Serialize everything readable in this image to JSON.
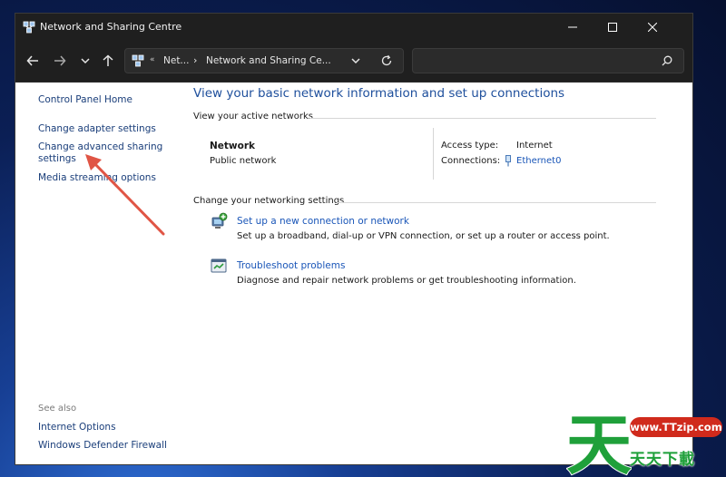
{
  "window": {
    "title": "Network and Sharing Centre"
  },
  "address_bar": {
    "overflow": "«",
    "crumb1": "Net...",
    "separator": "›",
    "crumb2": "Network and Sharing Ce..."
  },
  "search": {
    "placeholder": ""
  },
  "left_pane": {
    "home": "Control Panel Home",
    "adapter": "Change adapter settings",
    "advanced_line1": "Change advanced sharing",
    "advanced_line2": "settings",
    "media": "Media streaming options",
    "see_also": "See also",
    "internet_options": "Internet Options",
    "firewall": "Windows Defender Firewall"
  },
  "main": {
    "heading": "View your basic network information and set up connections",
    "active_networks_label": "View your active networks",
    "network_name": "Network",
    "network_type": "Public network",
    "access_type_label": "Access type:",
    "access_type_value": "Internet",
    "connections_label": "Connections:",
    "connections_value": "Ethernet0",
    "change_settings_label": "Change your networking settings",
    "tasks": [
      {
        "link": "Set up a new connection or network",
        "desc": "Set up a broadband, dial-up or VPN connection, or set up a router or access point."
      },
      {
        "link": "Troubleshoot problems",
        "desc": "Diagnose and repair network problems or get troubleshooting information."
      }
    ]
  },
  "watermark": {
    "big_char": "天",
    "url": "www.TTzip.com",
    "text": "天天下載"
  },
  "colors": {
    "title_bar": "#1f1f1f",
    "link": "#1a56b8",
    "heading": "#1e4f9c",
    "annotation_arrow": "#e05545",
    "watermark_green": "#1fa03a",
    "watermark_red": "#d02a1c"
  }
}
